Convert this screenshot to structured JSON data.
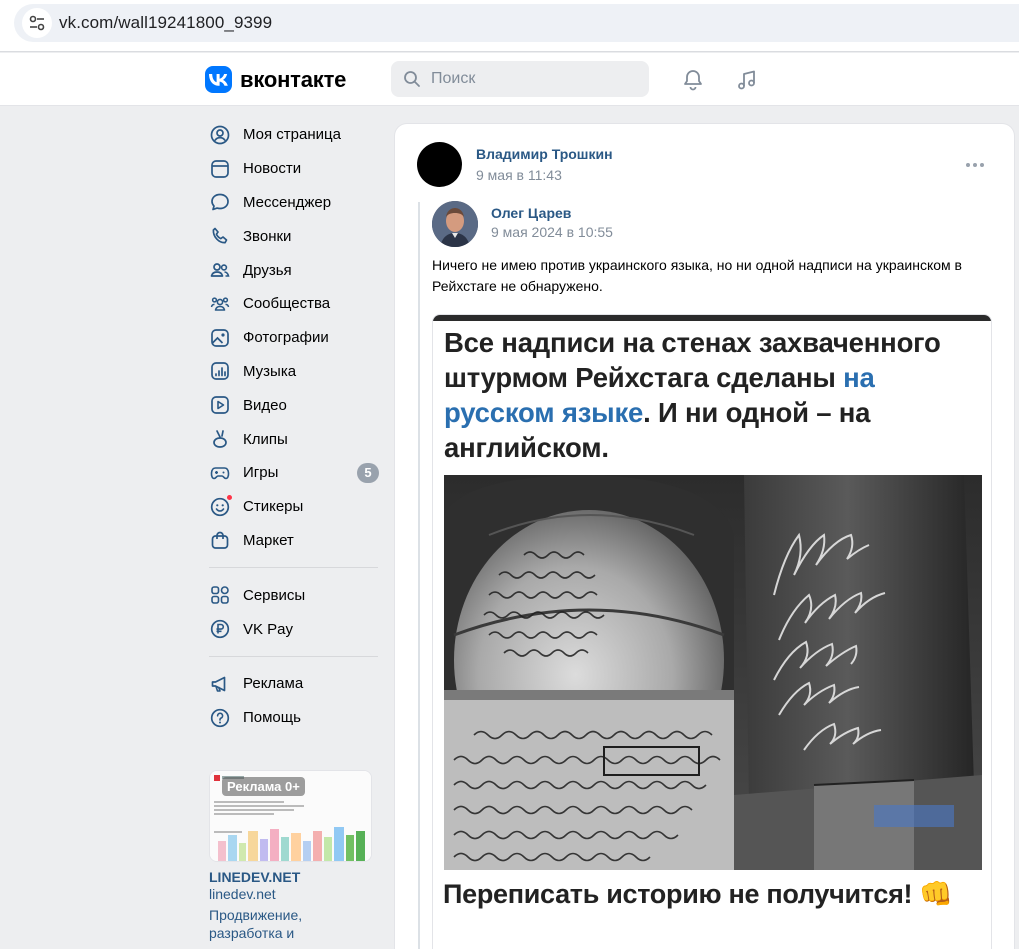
{
  "browser": {
    "url": "vk.com/wall19241800_9399"
  },
  "header": {
    "logo_text": "вконтакте",
    "search_placeholder": "Поиск",
    "icons": [
      "notifications-bell-icon",
      "music-note-icon"
    ]
  },
  "nav": {
    "items": [
      {
        "label": "Моя страница",
        "icon": "profile-icon"
      },
      {
        "label": "Новости",
        "icon": "news-icon"
      },
      {
        "label": "Мессенджер",
        "icon": "messenger-icon"
      },
      {
        "label": "Звонки",
        "icon": "phone-icon"
      },
      {
        "label": "Друзья",
        "icon": "friends-icon"
      },
      {
        "label": "Сообщества",
        "icon": "communities-icon"
      },
      {
        "label": "Фотографии",
        "icon": "photos-icon"
      },
      {
        "label": "Музыка",
        "icon": "music-icon"
      },
      {
        "label": "Видео",
        "icon": "video-icon"
      },
      {
        "label": "Клипы",
        "icon": "clips-icon"
      },
      {
        "label": "Игры",
        "icon": "games-icon",
        "badge": "5"
      },
      {
        "label": "Стикеры",
        "icon": "stickers-icon"
      },
      {
        "label": "Маркет",
        "icon": "market-icon"
      }
    ],
    "items2": [
      {
        "label": "Сервисы",
        "icon": "services-icon"
      },
      {
        "label": "VK Pay",
        "icon": "vkpay-icon"
      }
    ],
    "items3": [
      {
        "label": "Реклама",
        "icon": "megaphone-icon"
      },
      {
        "label": "Помощь",
        "icon": "help-icon"
      }
    ]
  },
  "ad": {
    "label": "Реклама 0+",
    "title": "LINEDEV.NET",
    "domain": "linedev.net",
    "desc": "Продвижение, разработка и"
  },
  "post": {
    "author": "Владимир Трошкин",
    "time": "9 мая в 11:43",
    "repost_author": "Олег Царев",
    "repost_time": "9 мая 2024 в 10:55",
    "text": "Ничего не имею против украинского языка, но ни одной надписи на украинском в Рейхстаге не обнаружено.",
    "image": {
      "headline_1": "Все надписи на стенах захваченного штурмом Рейхстага сделаны ",
      "headline_hl": "на русском языке",
      "headline_2": ". И ни одной – на английском.",
      "caption": "Переписать историю не получится!",
      "caption_emoji": "👊"
    }
  },
  "colors": {
    "vk_blue": "#0077ff",
    "link": "#2a5885",
    "secondary_text": "#818c99",
    "highlight": "#2a6fb0"
  }
}
